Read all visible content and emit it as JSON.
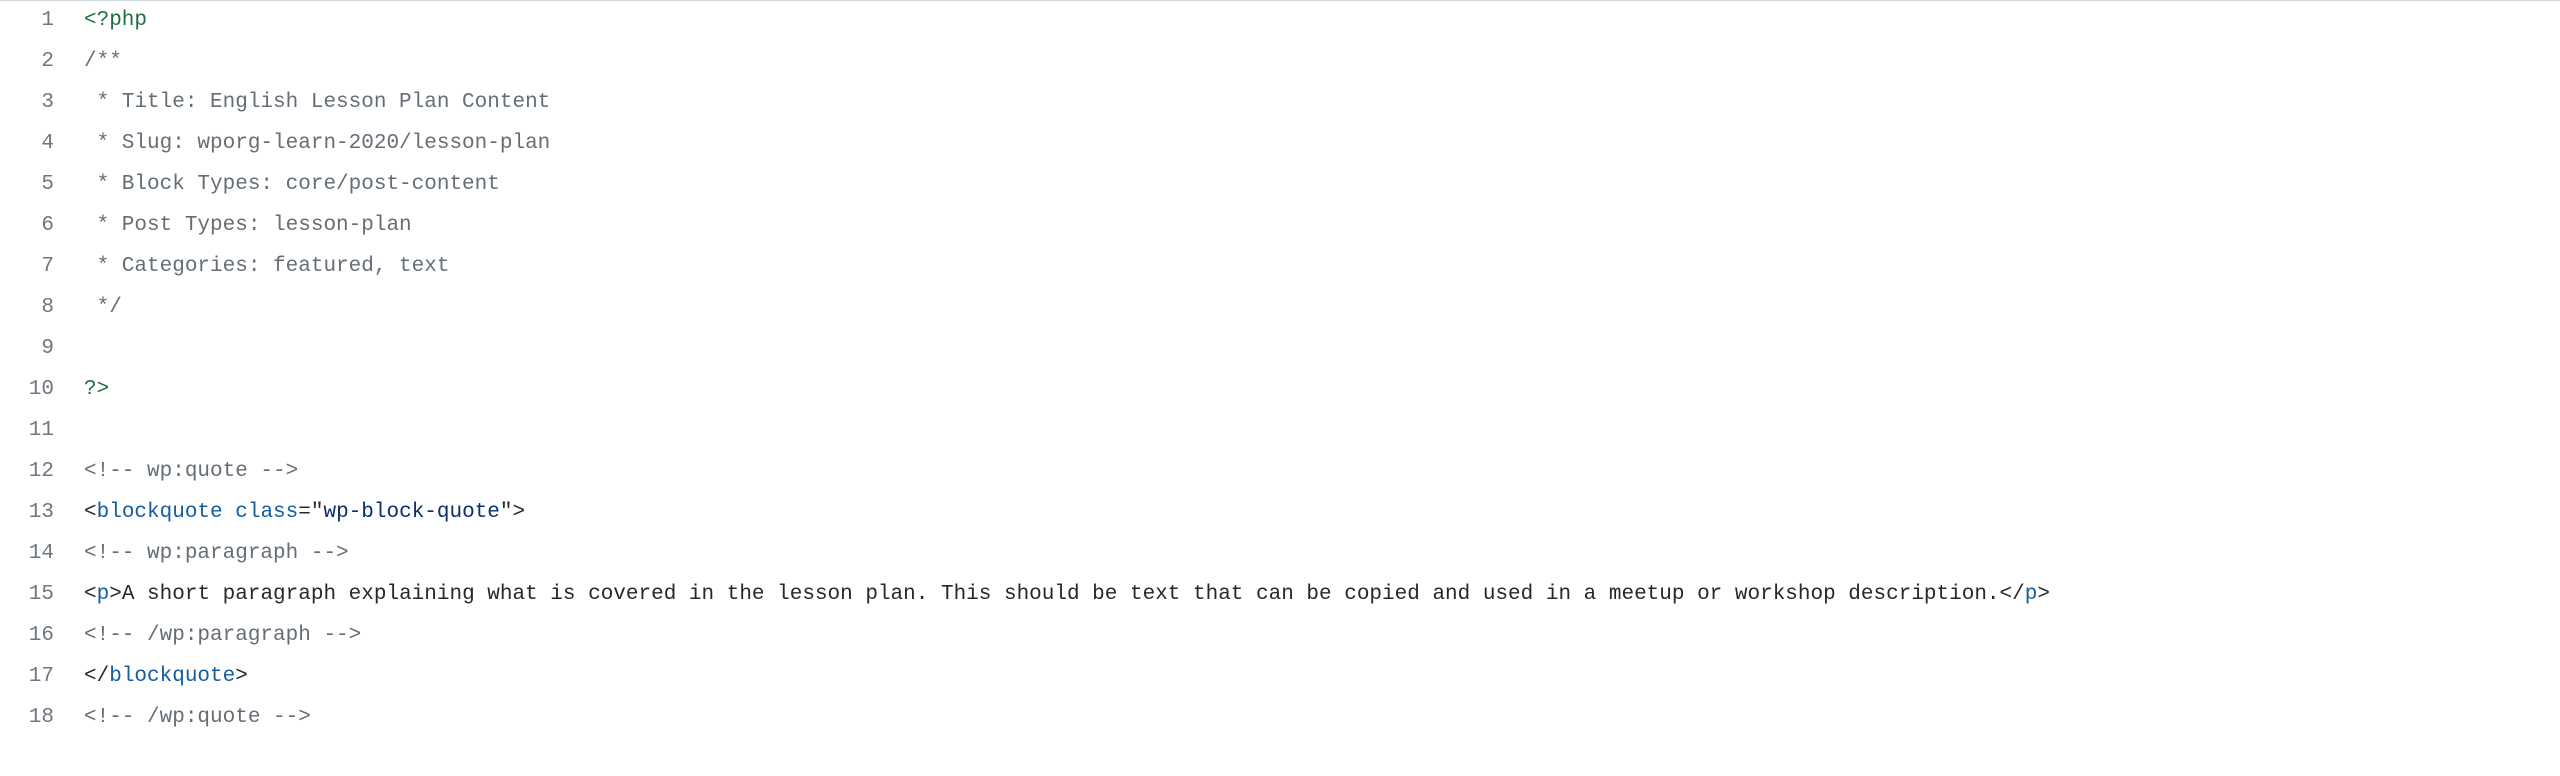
{
  "editor": {
    "lines": [
      {
        "num": 1,
        "tokens": [
          {
            "cls": "tok-php",
            "t": "<?php"
          }
        ]
      },
      {
        "num": 2,
        "tokens": [
          {
            "cls": "tok-comment",
            "t": "/**"
          }
        ]
      },
      {
        "num": 3,
        "tokens": [
          {
            "cls": "tok-comment",
            "t": " * Title: English Lesson Plan Content"
          }
        ]
      },
      {
        "num": 4,
        "tokens": [
          {
            "cls": "tok-comment",
            "t": " * Slug: wporg-learn-2020/lesson-plan"
          }
        ]
      },
      {
        "num": 5,
        "tokens": [
          {
            "cls": "tok-comment",
            "t": " * Block Types: core/post-content"
          }
        ]
      },
      {
        "num": 6,
        "tokens": [
          {
            "cls": "tok-comment",
            "t": " * Post Types: lesson-plan"
          }
        ]
      },
      {
        "num": 7,
        "tokens": [
          {
            "cls": "tok-comment",
            "t": " * Categories: featured, text"
          }
        ]
      },
      {
        "num": 8,
        "tokens": [
          {
            "cls": "tok-comment",
            "t": " */"
          }
        ]
      },
      {
        "num": 9,
        "tokens": [
          {
            "cls": "tok-text",
            "t": ""
          }
        ]
      },
      {
        "num": 10,
        "tokens": [
          {
            "cls": "tok-php",
            "t": "?>"
          }
        ]
      },
      {
        "num": 11,
        "tokens": [
          {
            "cls": "tok-text",
            "t": ""
          }
        ]
      },
      {
        "num": 12,
        "tokens": [
          {
            "cls": "tok-comment",
            "t": "<!-- wp:quote -->"
          }
        ]
      },
      {
        "num": 13,
        "tokens": [
          {
            "cls": "tok-punc",
            "t": "<"
          },
          {
            "cls": "tok-tagname",
            "t": "blockquote"
          },
          {
            "cls": "tok-text",
            "t": " "
          },
          {
            "cls": "tok-attr",
            "t": "class"
          },
          {
            "cls": "tok-punc",
            "t": "=\""
          },
          {
            "cls": "tok-string",
            "t": "wp-block-quote"
          },
          {
            "cls": "tok-punc",
            "t": "\">"
          }
        ]
      },
      {
        "num": 14,
        "tokens": [
          {
            "cls": "tok-comment",
            "t": "<!-- wp:paragraph -->"
          }
        ]
      },
      {
        "num": 15,
        "tokens": [
          {
            "cls": "tok-punc",
            "t": "<"
          },
          {
            "cls": "tok-tagname",
            "t": "p"
          },
          {
            "cls": "tok-punc",
            "t": ">"
          },
          {
            "cls": "tok-text",
            "t": "A short paragraph explaining what is covered in the lesson plan. This should be text that can be copied and used in a meetup or workshop description."
          },
          {
            "cls": "tok-punc",
            "t": "</"
          },
          {
            "cls": "tok-tagname",
            "t": "p"
          },
          {
            "cls": "tok-punc",
            "t": ">"
          }
        ]
      },
      {
        "num": 16,
        "tokens": [
          {
            "cls": "tok-comment",
            "t": "<!-- /wp:paragraph -->"
          }
        ]
      },
      {
        "num": 17,
        "tokens": [
          {
            "cls": "tok-punc",
            "t": "</"
          },
          {
            "cls": "tok-tagname",
            "t": "blockquote"
          },
          {
            "cls": "tok-punc",
            "t": ">"
          }
        ]
      },
      {
        "num": 18,
        "tokens": [
          {
            "cls": "tok-comment",
            "t": "<!-- /wp:quote -->"
          }
        ]
      }
    ]
  }
}
